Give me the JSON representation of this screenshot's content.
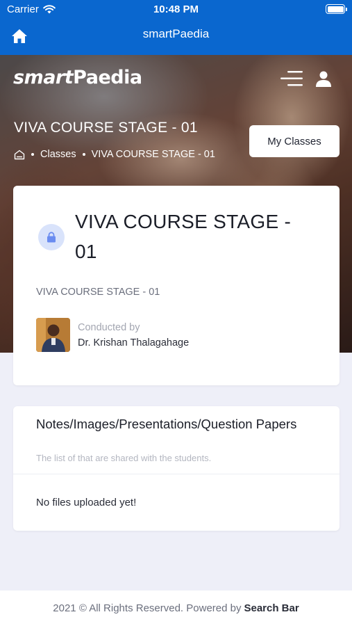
{
  "status_bar": {
    "carrier": "Carrier",
    "time": "10:48 PM"
  },
  "nav_bar": {
    "title": "smartPaedia"
  },
  "hero": {
    "brand_prefix": "smart",
    "brand_suffix": "Paedia",
    "page_heading": "VIVA COURSE STAGE - 01",
    "breadcrumb": {
      "classes": "Classes",
      "current": "VIVA COURSE STAGE - 01"
    },
    "my_classes_label": "My Classes"
  },
  "course_card": {
    "title": "VIVA COURSE STAGE - 01",
    "subtitle": "VIVA COURSE STAGE - 01",
    "conducted_by_label": "Conducted by",
    "teacher_name": "Dr. Krishan Thalagahage"
  },
  "files_card": {
    "title": "Notes/Images/Presentations/Question Papers",
    "subtitle": "The list of that are shared with the students.",
    "empty_message": "No files uploaded yet!"
  },
  "footer": {
    "text": "2021 © All Rights Reserved. Powered by",
    "link": "Search Bar"
  },
  "colors": {
    "nav_blue": "#0a67cf",
    "page_bg": "#eeeff8",
    "lock_bg": "#d9e3fb",
    "lock_fg": "#6a8cf0"
  },
  "icons": [
    "wifi-icon",
    "battery-icon",
    "home-icon",
    "menu-icon",
    "user-icon",
    "breadcrumb-home-icon",
    "lock-icon"
  ]
}
